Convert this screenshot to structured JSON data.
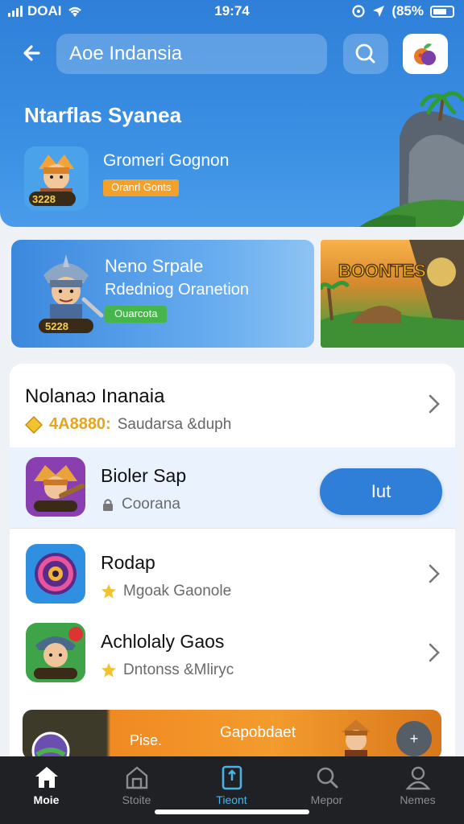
{
  "status_bar": {
    "carrier": "DOAI",
    "time": "19:74",
    "battery": "(85%"
  },
  "header": {
    "back_icon": "arrow-left-icon",
    "search_value": "Aoe Indansia",
    "search_icon": "search-icon",
    "avatar_icon": "fruit-avatar-icon"
  },
  "hero": {
    "title": "Ntarflas Syanea",
    "game_name": "Gromeri Gognon",
    "badge": "Oranrl Gonts",
    "icon_value": "3228"
  },
  "promo": {
    "title": "Neno Srpale",
    "subtitle": "Rdedniog Oranetion",
    "badge": "Ouarcota",
    "icon_value": "5228",
    "side_label": "BOONTES"
  },
  "section": {
    "title": "Nolanaɔ Inanaia",
    "gem_value": "4A8880:",
    "subtitle": "Saudarsa &duph"
  },
  "apps": [
    {
      "title": "Bioler Sap",
      "subtitle": "Coorana",
      "sub_icon": "lock-icon",
      "action": "Iut"
    },
    {
      "title": "Rodap",
      "subtitle": "Mgoak Gaonole",
      "sub_icon": "star-icon"
    },
    {
      "title": "Achlolaly Gaos",
      "subtitle": "Dntonss &Mliryc",
      "sub_icon": "star-icon"
    }
  ],
  "banner": {
    "left_text": "Pise.",
    "center_text": "Gapobdaet",
    "fab_label": "+"
  },
  "tabs": [
    {
      "label": "Moie",
      "icon": "home-icon"
    },
    {
      "label": "Stoite",
      "icon": "store-icon"
    },
    {
      "label": "Tieont",
      "icon": "tablet-icon"
    },
    {
      "label": "Mepor",
      "icon": "search-icon"
    },
    {
      "label": "Nemes",
      "icon": "profile-icon"
    }
  ],
  "colors": {
    "primary": "#2f7fd8",
    "gold": "#e5a51c",
    "orange_badge": "#f3a12b",
    "green_badge": "#46b54b",
    "tabbar": "#202124",
    "tab_accent": "#4db3e6"
  }
}
